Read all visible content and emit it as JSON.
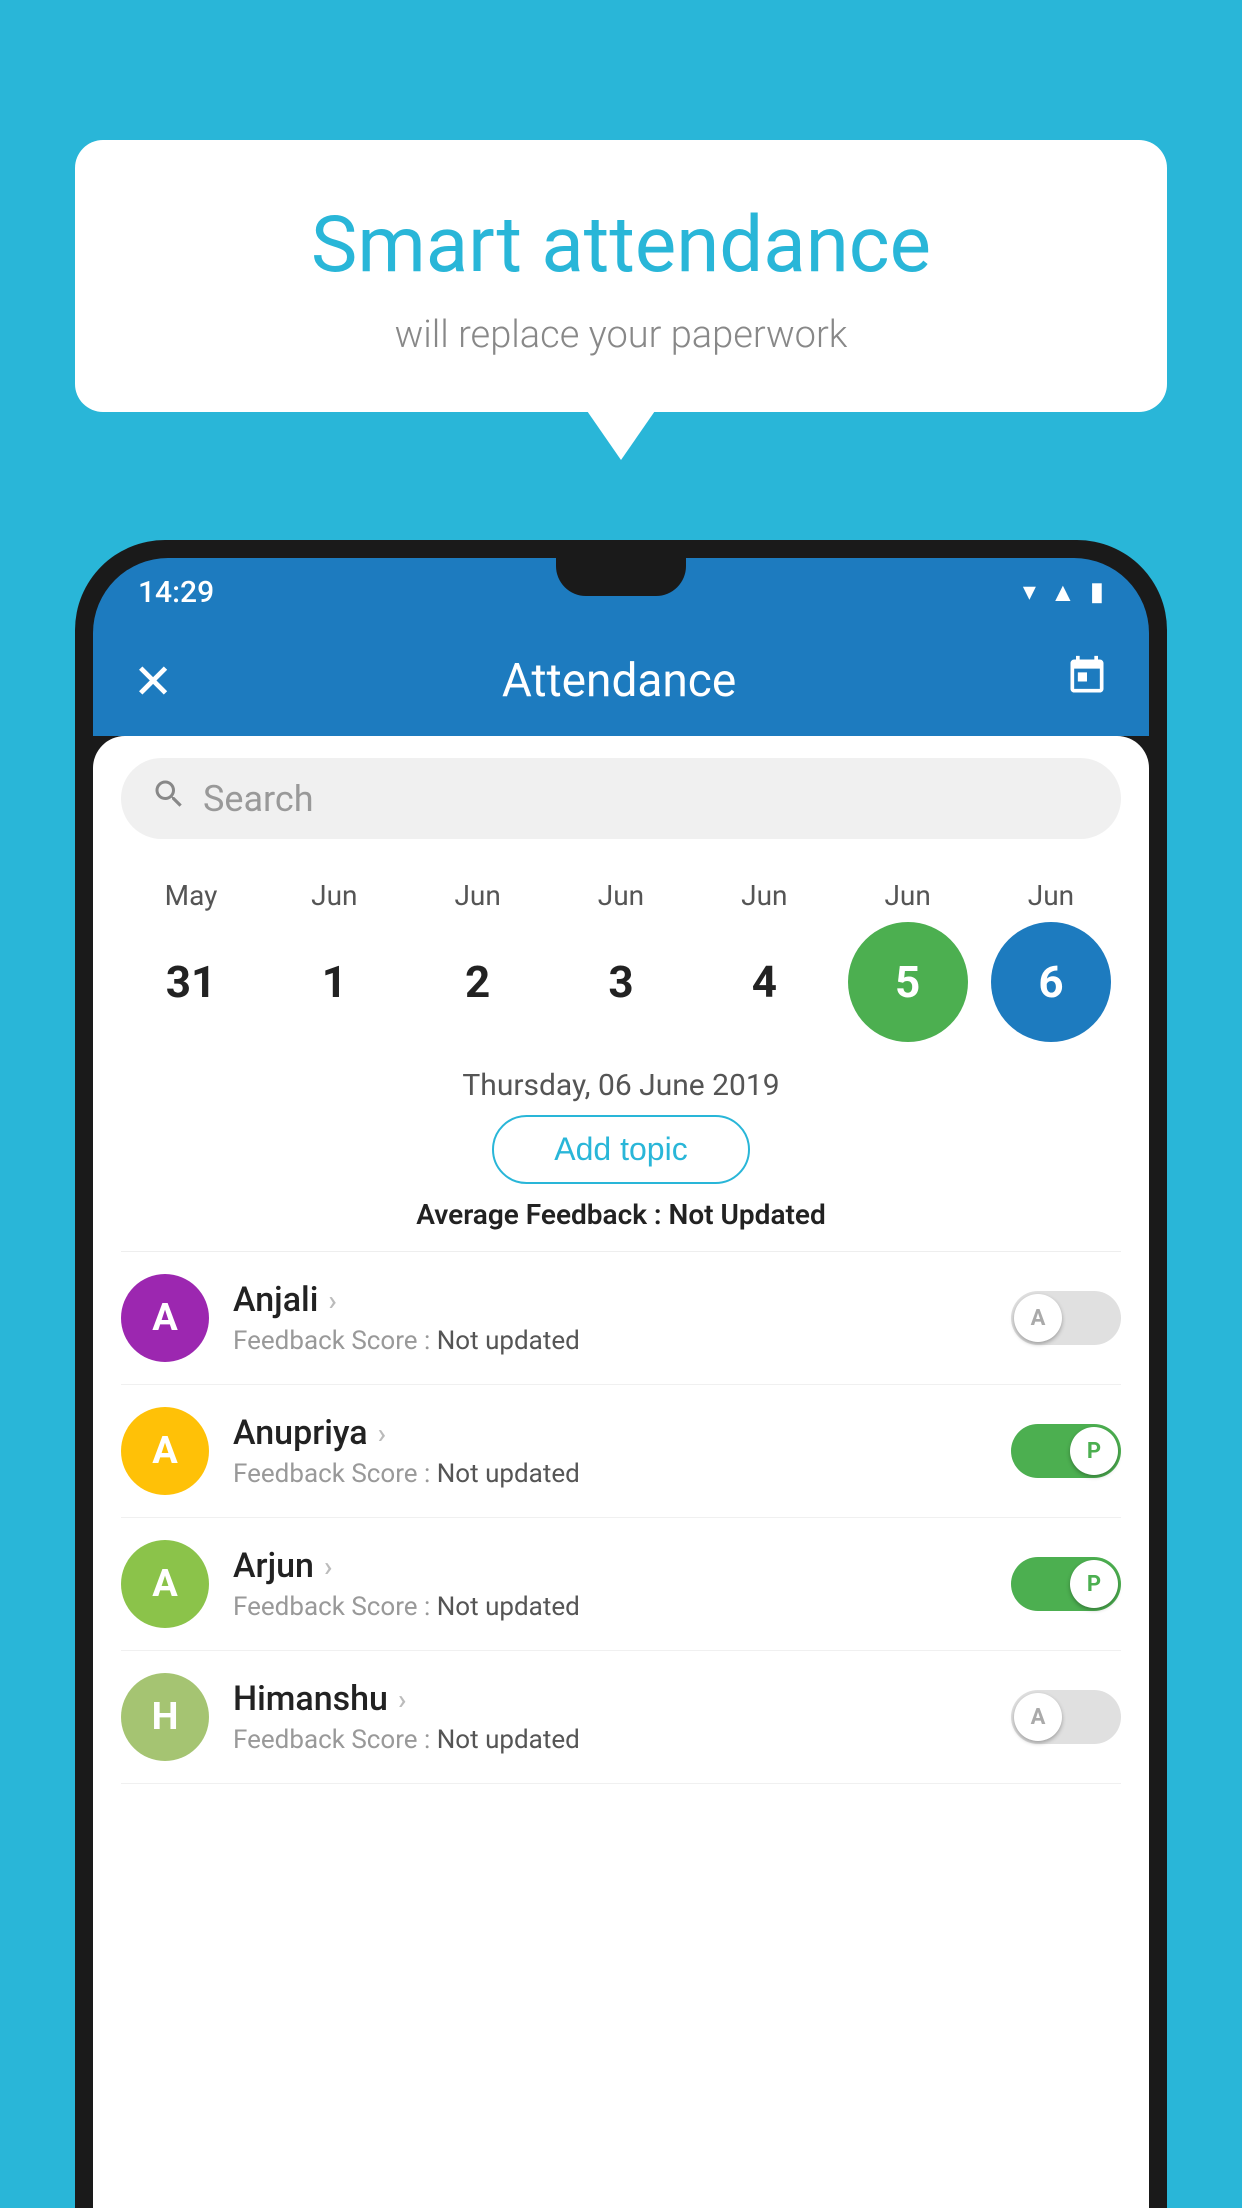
{
  "background_color": "#29b6d8",
  "speech_bubble": {
    "title": "Smart attendance",
    "subtitle": "will replace your paperwork"
  },
  "status_bar": {
    "time": "14:29"
  },
  "app_bar": {
    "title": "Attendance",
    "close_label": "×",
    "calendar_icon": "📅"
  },
  "search": {
    "placeholder": "Search"
  },
  "calendar": {
    "months": [
      "May",
      "Jun",
      "Jun",
      "Jun",
      "Jun",
      "Jun",
      "Jun"
    ],
    "days": [
      {
        "day": "31",
        "state": "normal"
      },
      {
        "day": "1",
        "state": "normal"
      },
      {
        "day": "2",
        "state": "normal"
      },
      {
        "day": "3",
        "state": "normal"
      },
      {
        "day": "4",
        "state": "normal"
      },
      {
        "day": "5",
        "state": "today"
      },
      {
        "day": "6",
        "state": "selected"
      }
    ]
  },
  "selected_date": "Thursday, 06 June 2019",
  "add_topic_label": "Add topic",
  "avg_feedback_label": "Average Feedback :",
  "avg_feedback_value": "Not Updated",
  "students": [
    {
      "name": "Anjali",
      "avatar_letter": "A",
      "avatar_color": "#9c27b0",
      "feedback_label": "Feedback Score :",
      "feedback_value": "Not updated",
      "toggle_state": "off",
      "toggle_letter": "A"
    },
    {
      "name": "Anupriya",
      "avatar_letter": "A",
      "avatar_color": "#ffc107",
      "feedback_label": "Feedback Score :",
      "feedback_value": "Not updated",
      "toggle_state": "on",
      "toggle_letter": "P"
    },
    {
      "name": "Arjun",
      "avatar_letter": "A",
      "avatar_color": "#8bc34a",
      "feedback_label": "Feedback Score :",
      "feedback_value": "Not updated",
      "toggle_state": "on",
      "toggle_letter": "P"
    },
    {
      "name": "Himanshu",
      "avatar_letter": "H",
      "avatar_color": "#a5c472",
      "feedback_label": "Feedback Score :",
      "feedback_value": "Not updated",
      "toggle_state": "off",
      "toggle_letter": "A"
    }
  ]
}
